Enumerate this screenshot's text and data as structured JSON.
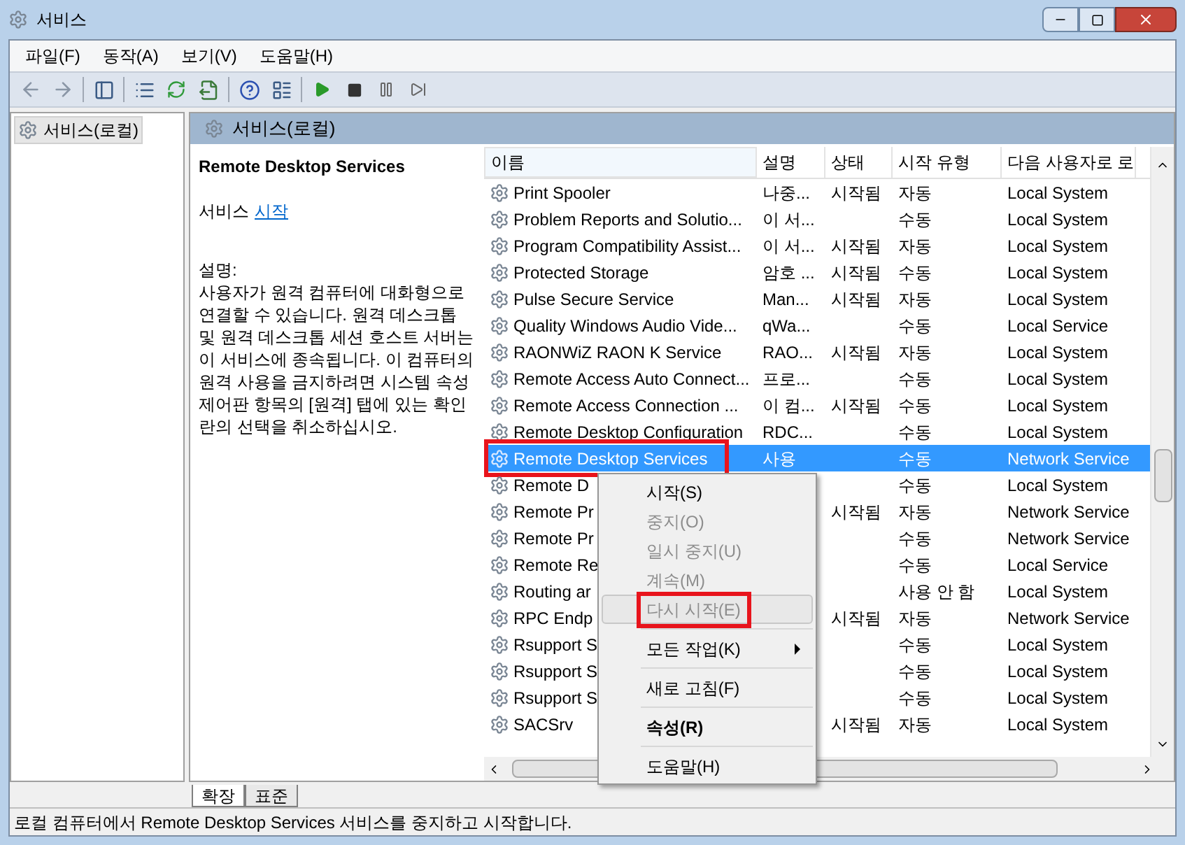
{
  "window": {
    "title": "서비스"
  },
  "menu": [
    "파일(F)",
    "동작(A)",
    "보기(V)",
    "도움말(H)"
  ],
  "tree": {
    "items": [
      {
        "label": "서비스(로컬)",
        "selected": true
      }
    ]
  },
  "pane_title": "서비스(로컬)",
  "details": {
    "service_name": "Remote Desktop Services",
    "action_prefix": "서비스",
    "action_link": "시작",
    "description_label": "설명:",
    "description": "사용자가 원격 컴퓨터에 대화형으로 연결할 수 있습니다. 원격 데스크톱 및 원격 데스크톱 세션 호스트 서버는 이 서비스에 종속됩니다. 이 컴퓨터의 원격 사용을 금지하려면 시스템 속성 제어판 항목의 [원격] 탭에 있는 확인란의 선택을 취소하십시오."
  },
  "table": {
    "columns": [
      "이름",
      "설명",
      "상태",
      "시작 유형",
      "다음 사용자로 로"
    ],
    "rows": [
      {
        "name": "Print Spooler",
        "description": "나중...",
        "status": "시작됨",
        "startup": "자동",
        "logon": "Local System",
        "selected": false,
        "highlighted": false
      },
      {
        "name": "Problem Reports and Solutio...",
        "description": "이 서...",
        "status": "",
        "startup": "수동",
        "logon": "Local System",
        "selected": false,
        "highlighted": false
      },
      {
        "name": "Program Compatibility Assist...",
        "description": "이 서...",
        "status": "시작됨",
        "startup": "자동",
        "logon": "Local System",
        "selected": false,
        "highlighted": false
      },
      {
        "name": "Protected Storage",
        "description": "암호 ...",
        "status": "시작됨",
        "startup": "수동",
        "logon": "Local System",
        "selected": false,
        "highlighted": false
      },
      {
        "name": "Pulse Secure Service",
        "description": "Man...",
        "status": "시작됨",
        "startup": "자동",
        "logon": "Local System",
        "selected": false,
        "highlighted": false
      },
      {
        "name": "Quality Windows Audio Vide...",
        "description": "qWa...",
        "status": "",
        "startup": "수동",
        "logon": "Local Service",
        "selected": false,
        "highlighted": false
      },
      {
        "name": "RAONWiZ RAON K Service",
        "description": "RAO...",
        "status": "시작됨",
        "startup": "자동",
        "logon": "Local System",
        "selected": false,
        "highlighted": false
      },
      {
        "name": "Remote Access Auto Connect...",
        "description": "프로...",
        "status": "",
        "startup": "수동",
        "logon": "Local System",
        "selected": false,
        "highlighted": false
      },
      {
        "name": "Remote Access Connection ...",
        "description": "이 컴...",
        "status": "시작됨",
        "startup": "수동",
        "logon": "Local System",
        "selected": false,
        "highlighted": false
      },
      {
        "name": "Remote Desktop Configuration",
        "description": "RDC...",
        "status": "",
        "startup": "수동",
        "logon": "Local System",
        "selected": false,
        "highlighted": false
      },
      {
        "name": "Remote Desktop Services",
        "description": "사용",
        "status": "",
        "startup": "수동",
        "logon": "Network Service",
        "selected": true,
        "highlighted": true
      },
      {
        "name": "Remote D",
        "description": "",
        "status": "",
        "startup": "수동",
        "logon": "Local System",
        "selected": false,
        "highlighted": false
      },
      {
        "name": "Remote Pr",
        "description": "",
        "status": "시작됨",
        "startup": "자동",
        "logon": "Network Service",
        "selected": false,
        "highlighted": false
      },
      {
        "name": "Remote Pr",
        "description": "",
        "status": "",
        "startup": "수동",
        "logon": "Network Service",
        "selected": false,
        "highlighted": false
      },
      {
        "name": "Remote Re",
        "description": "",
        "status": "",
        "startup": "수동",
        "logon": "Local Service",
        "selected": false,
        "highlighted": false
      },
      {
        "name": "Routing ar",
        "description": "",
        "status": "",
        "startup": "사용 안 함",
        "logon": "Local System",
        "selected": false,
        "highlighted": false
      },
      {
        "name": "RPC Endp",
        "description": "",
        "status": "시작됨",
        "startup": "자동",
        "logon": "Network Service",
        "selected": false,
        "highlighted": false
      },
      {
        "name": "Rsupport S",
        "description": "",
        "status": "",
        "startup": "수동",
        "logon": "Local System",
        "selected": false,
        "highlighted": false
      },
      {
        "name": "Rsupport S",
        "description": "",
        "status": "",
        "startup": "수동",
        "logon": "Local System",
        "selected": false,
        "highlighted": false
      },
      {
        "name": "Rsupport S",
        "description": "",
        "status": "",
        "startup": "수동",
        "logon": "Local System",
        "selected": false,
        "highlighted": false
      },
      {
        "name": "SACSrv",
        "description": "",
        "status": "시작됨",
        "startup": "자동",
        "logon": "Local System",
        "selected": false,
        "highlighted": false
      }
    ]
  },
  "context_menu": [
    {
      "kind": "item",
      "label": "시작(S)",
      "disabled": false,
      "bold": false,
      "submenu": false,
      "hovered": false,
      "highlighted": false
    },
    {
      "kind": "item",
      "label": "중지(O)",
      "disabled": true,
      "bold": false,
      "submenu": false,
      "hovered": false,
      "highlighted": false
    },
    {
      "kind": "item",
      "label": "일시 중지(U)",
      "disabled": true,
      "bold": false,
      "submenu": false,
      "hovered": false,
      "highlighted": false
    },
    {
      "kind": "item",
      "label": "계속(M)",
      "disabled": true,
      "bold": false,
      "submenu": false,
      "hovered": false,
      "highlighted": false
    },
    {
      "kind": "item",
      "label": "다시 시작(E)",
      "disabled": true,
      "bold": false,
      "submenu": false,
      "hovered": true,
      "highlighted": true
    },
    {
      "kind": "separator"
    },
    {
      "kind": "item",
      "label": "모든 작업(K)",
      "disabled": false,
      "bold": false,
      "submenu": true,
      "hovered": false,
      "highlighted": false
    },
    {
      "kind": "separator"
    },
    {
      "kind": "item",
      "label": "새로 고침(F)",
      "disabled": false,
      "bold": false,
      "submenu": false,
      "hovered": false,
      "highlighted": false
    },
    {
      "kind": "separator"
    },
    {
      "kind": "item",
      "label": "속성(R)",
      "disabled": false,
      "bold": true,
      "submenu": false,
      "hovered": false,
      "highlighted": false
    },
    {
      "kind": "separator"
    },
    {
      "kind": "item",
      "label": "도움말(H)",
      "disabled": false,
      "bold": false,
      "submenu": false,
      "hovered": false,
      "highlighted": false
    }
  ],
  "view_tabs": [
    {
      "label": "확장",
      "selected": true
    },
    {
      "label": "표준",
      "selected": false
    }
  ],
  "status_bar": "로컬 컴퓨터에서 Remote Desktop Services 서비스를 중지하고 시작합니다."
}
